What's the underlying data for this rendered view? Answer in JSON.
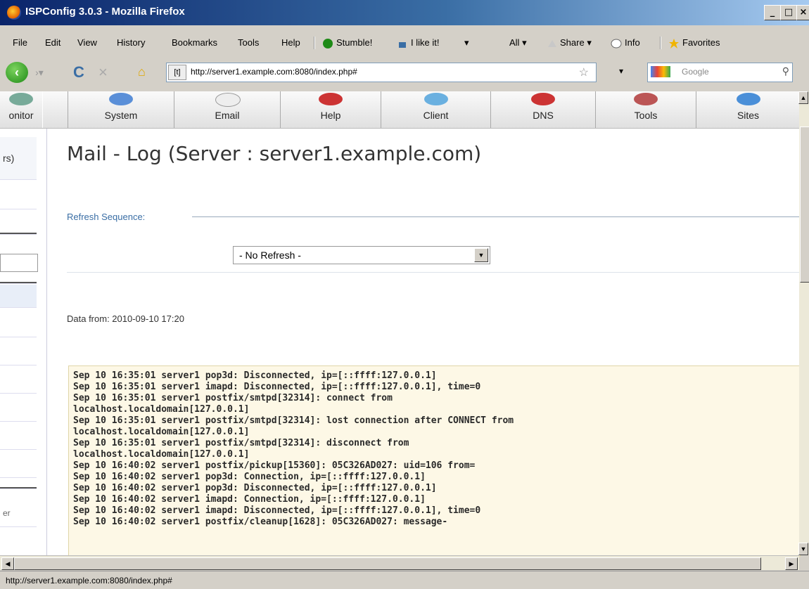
{
  "window": {
    "title": "ISPConfig 3.0.3 - Mozilla Firefox",
    "minimize": "_",
    "restore": "□",
    "close": "×"
  },
  "menu": {
    "items": [
      "File",
      "Edit",
      "View",
      "History",
      "Bookmarks",
      "Tools",
      "Help"
    ],
    "toolbar": [
      "Stumble!",
      "I like it!",
      "All",
      "Share",
      "Info",
      "Favorites"
    ]
  },
  "nav": {
    "url": "http://server1.example.com:8080/index.php#",
    "search_placeholder": "Google"
  },
  "tabs": {
    "items": [
      {
        "label": "onitor",
        "icon": "monitor-icon"
      },
      {
        "label": "System",
        "icon": "system-icon"
      },
      {
        "label": "Email",
        "icon": "email-icon"
      },
      {
        "label": "Help",
        "icon": "help-icon"
      },
      {
        "label": "Client",
        "icon": "client-icon"
      },
      {
        "label": "DNS",
        "icon": "dns-icon"
      },
      {
        "label": "Tools",
        "icon": "tools-icon"
      },
      {
        "label": "Sites",
        "icon": "sites-icon"
      }
    ]
  },
  "sidebar": {
    "fragment": "rs)",
    "fragment2": "er"
  },
  "main": {
    "heading": "Mail - Log (Server : server1.example.com)",
    "refresh_label": "Refresh Sequence:",
    "refresh_value": "- No Refresh -",
    "data_from": "Data from: 2010-09-10 17:20"
  },
  "log": {
    "text": "Sep 10 16:35:01 server1 pop3d: Disconnected, ip=[::ffff:127.0.0.1]\nSep 10 16:35:01 server1 imapd: Disconnected, ip=[::ffff:127.0.0.1], time=0\nSep 10 16:35:01 server1 postfix/smtpd[32314]: connect from\nlocalhost.localdomain[127.0.0.1]\nSep 10 16:35:01 server1 postfix/smtpd[32314]: lost connection after CONNECT from\nlocalhost.localdomain[127.0.0.1]\nSep 10 16:35:01 server1 postfix/smtpd[32314]: disconnect from\nlocalhost.localdomain[127.0.0.1]\nSep 10 16:40:02 server1 postfix/pickup[15360]: 05C326AD027: uid=106 from=\nSep 10 16:40:02 server1 pop3d: Connection, ip=[::ffff:127.0.0.1]\nSep 10 16:40:02 server1 pop3d: Disconnected, ip=[::ffff:127.0.0.1]\nSep 10 16:40:02 server1 imapd: Connection, ip=[::ffff:127.0.0.1]\nSep 10 16:40:02 server1 imapd: Disconnected, ip=[::ffff:127.0.0.1], time=0\nSep 10 16:40:02 server1 postfix/cleanup[1628]: 05C326AD027: message-"
  },
  "status": {
    "text": "http://server1.example.com:8080/index.php#"
  }
}
